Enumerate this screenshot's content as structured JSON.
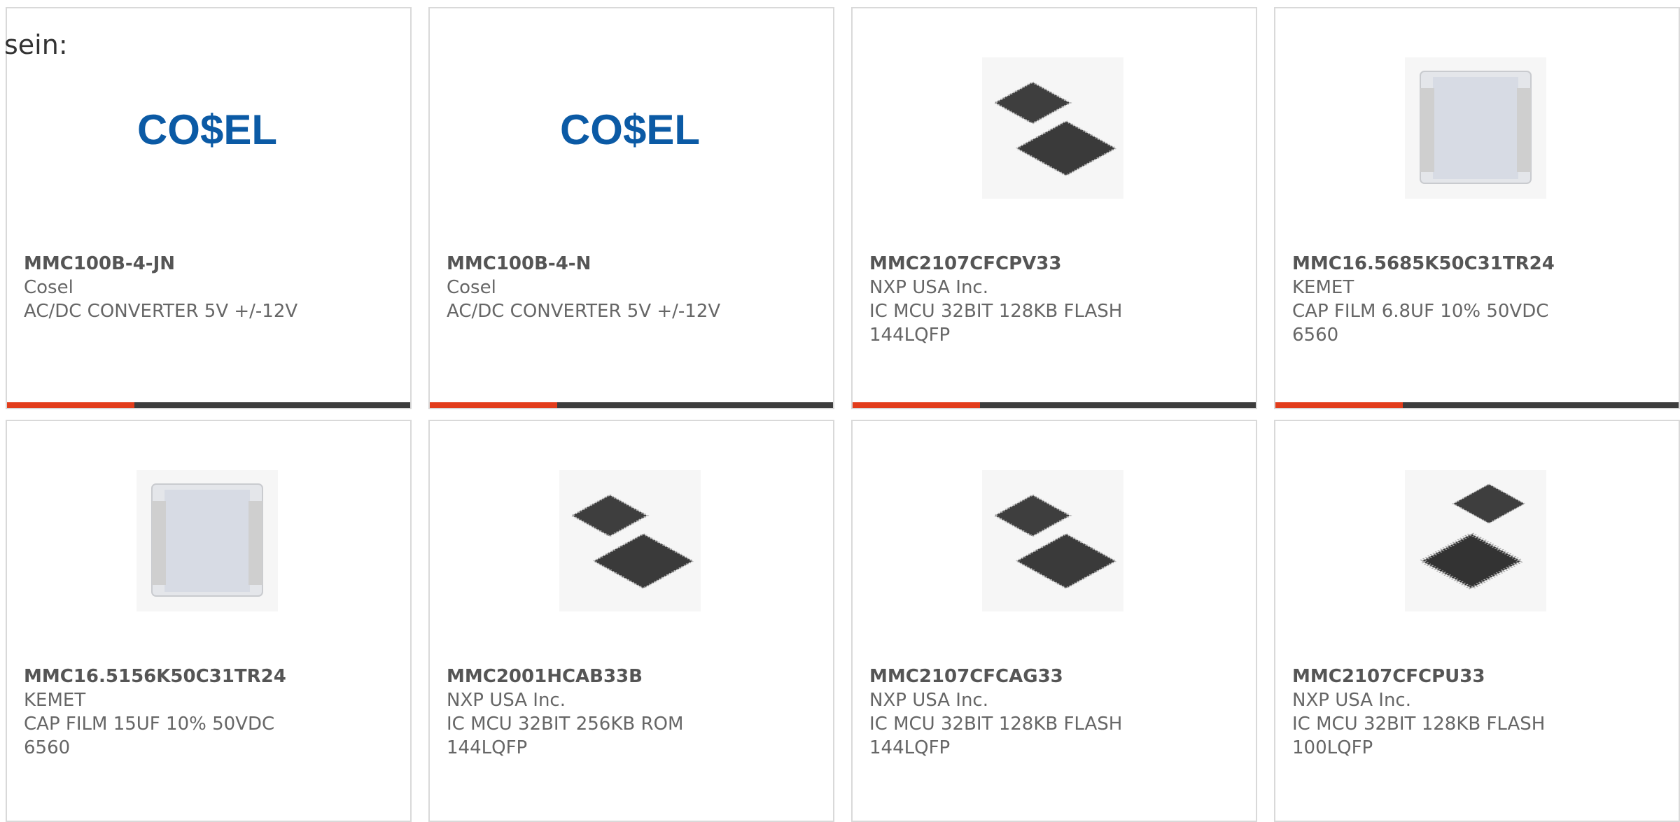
{
  "intro_text": "sein:",
  "brand": {
    "accent": "#e23d1c",
    "bar": "#3d3d3d",
    "cosel_blue": "#0b5aa5"
  },
  "products": [
    {
      "part_number": "MMC100B-4-JN",
      "manufacturer": "Cosel",
      "description": "AC/DC CONVERTER 5V +/-12V",
      "image": "cosel-logo",
      "logo_text": "CO$EL"
    },
    {
      "part_number": "MMC100B-4-N",
      "manufacturer": "Cosel",
      "description": "AC/DC CONVERTER 5V +/-12V",
      "image": "cosel-logo",
      "logo_text": "CO$EL"
    },
    {
      "part_number": "MMC2107CFCPV33",
      "manufacturer": "NXP USA Inc.",
      "description": "IC MCU 32BIT 128KB FLASH 144LQFP",
      "image": "ic-chip-pair"
    },
    {
      "part_number": "MMC16.5685K50C31TR24",
      "manufacturer": "KEMET",
      "description": "CAP FILM 6.8UF 10% 50VDC 6560",
      "image": "film-capacitor"
    },
    {
      "part_number": "MMC16.5156K50C31TR24",
      "manufacturer": "KEMET",
      "description": "CAP FILM 15UF 10% 50VDC 6560",
      "image": "film-capacitor"
    },
    {
      "part_number": "MMC2001HCAB33B",
      "manufacturer": "NXP USA Inc.",
      "description": "IC MCU 32BIT 256KB ROM 144LQFP",
      "image": "ic-chip-pair"
    },
    {
      "part_number": "MMC2107CFCAG33",
      "manufacturer": "NXP USA Inc.",
      "description": "IC MCU 32BIT 128KB FLASH 144LQFP",
      "image": "ic-chip-pair"
    },
    {
      "part_number": "MMC2107CFCPU33",
      "manufacturer": "NXP USA Inc.",
      "description": "IC MCU 32BIT 128KB FLASH 100LQFP",
      "image": "ic-chip-pair-leaded"
    }
  ]
}
